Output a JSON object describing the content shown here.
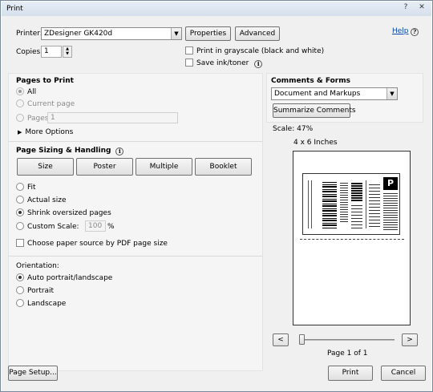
{
  "window": {
    "title": "Print",
    "help_icon": "question-icon",
    "close_icon": "close-icon"
  },
  "printer": {
    "label": "Printer:",
    "selected": "ZDesigner GK420d",
    "properties_label": "Properties",
    "advanced_label": "Advanced",
    "help_label": "Help"
  },
  "copies": {
    "label": "Copies:",
    "value": "1"
  },
  "options": {
    "grayscale_label": "Print in grayscale (black and white)",
    "save_ink_label": "Save ink/toner"
  },
  "pages_to_print": {
    "heading": "Pages to Print",
    "all_label": "All",
    "current_page_label": "Current page",
    "pages_label": "Pages",
    "pages_value": "1",
    "more_options_label": "More Options"
  },
  "sizing": {
    "heading": "Page Sizing & Handling",
    "tabs": [
      "Size",
      "Poster",
      "Multiple",
      "Booklet"
    ],
    "fit_label": "Fit",
    "actual_size_label": "Actual size",
    "shrink_label": "Shrink oversized pages",
    "custom_scale_label": "Custom Scale:",
    "custom_scale_value": "100",
    "percent": "%",
    "paper_source_label": "Choose paper source by PDF page size"
  },
  "orientation": {
    "heading": "Orientation:",
    "auto_label": "Auto portrait/landscape",
    "portrait_label": "Portrait",
    "landscape_label": "Landscape"
  },
  "comments": {
    "heading": "Comments & Forms",
    "selected": "Document and Markups",
    "summarize_label": "Summarize Comments"
  },
  "preview": {
    "scale_label": "Scale:",
    "scale_value": "47%",
    "page_size": "4 x 6 Inches",
    "page_info": "Page 1 of 1",
    "prev_label": "<",
    "next_label": ">",
    "label_char": "P",
    "slider_value": 0
  },
  "footer": {
    "page_setup_label": "Page Setup...",
    "print_label": "Print",
    "cancel_label": "Cancel"
  }
}
